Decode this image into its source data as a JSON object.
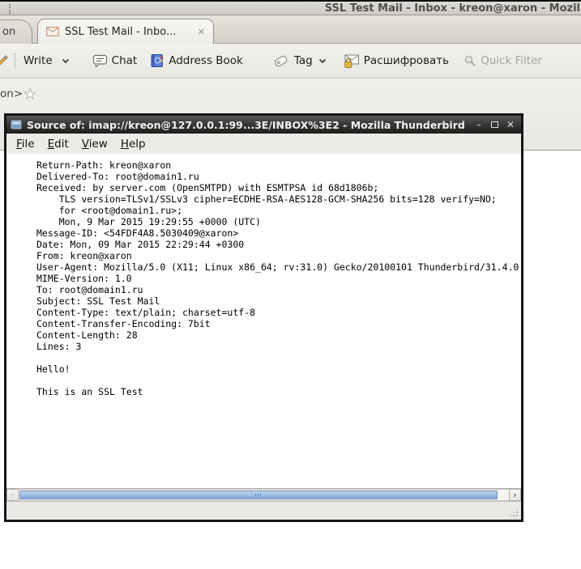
{
  "main_window": {
    "title": "SSL Test Mail - Inbox - kreon@xaron - Mozil",
    "tabbar": {
      "partial_left_tab": "on",
      "active_tab": {
        "label": "SSL Test Mail - Inbo...",
        "close_glyph": "✕"
      }
    },
    "toolbar": {
      "write_label": "Write",
      "chat_label": "Chat",
      "address_book_label": "Address Book",
      "tag_label": "Tag",
      "decrypt_label": "Расшифровать",
      "quick_filter_label": "Quick Filter"
    },
    "message_header": {
      "partial_text": "on>"
    }
  },
  "source_window": {
    "title": "Source of: imap://kreon@127.0.0.1:99...3E/INBOX%3E2 - Mozilla Thunderbird",
    "controls": {
      "minimize_glyph": "–",
      "close_glyph": "✕"
    },
    "menus": [
      "File",
      "Edit",
      "View",
      "Help"
    ],
    "source_lines": [
      "Return-Path: kreon@xaron",
      "Delivered-To: root@domain1.ru",
      "Received: by server.com (OpenSMTPD) with ESMTPSA id 68d1806b;",
      "    TLS version=TLSv1/SSLv3 cipher=ECDHE-RSA-AES128-GCM-SHA256 bits=128 verify=NO;",
      "    for <root@domain1.ru>;",
      "    Mon, 9 Mar 2015 19:29:55 +0000 (UTC)",
      "Message-ID: <54FDF4A8.5030409@xaron>",
      "Date: Mon, 09 Mar 2015 22:29:44 +0300",
      "From: kreon@xaron",
      "User-Agent: Mozilla/5.0 (X11; Linux x86_64; rv:31.0) Gecko/20100101 Thunderbird/31.4.0",
      "MIME-Version: 1.0",
      "To: root@domain1.ru",
      "Subject: SSL Test Mail",
      "Content-Type: text/plain; charset=utf-8",
      "Content-Transfer-Encoding: 7bit",
      "Content-Length: 28",
      "Lines: 3",
      "",
      "Hello!",
      "",
      "This is an SSL Test"
    ]
  },
  "colors": {
    "accent_scrollbar": "#87abd6",
    "source_titlebar_dark": "#1d1d1c",
    "decrypt_lock_gold": "#e8b93e"
  }
}
